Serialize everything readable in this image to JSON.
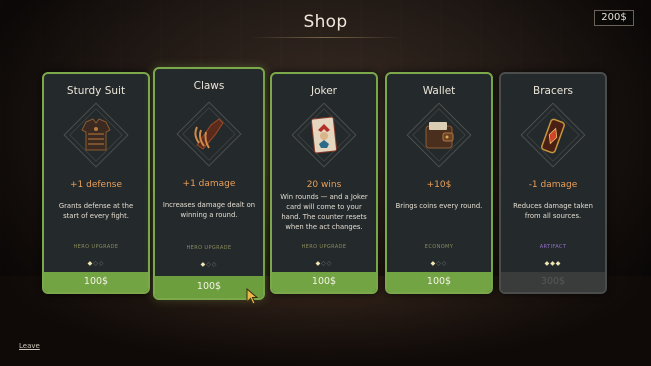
{
  "header": {
    "title": "Shop",
    "money": "200$"
  },
  "footer": {
    "leave_label": "Leave"
  },
  "colors": {
    "frame_green": "#7aa84a",
    "price_green": "#73a444",
    "stat_orange": "#e9a05a",
    "artifact_purple": "#8f72c9"
  },
  "cards": [
    {
      "name": "Sturdy Suit",
      "stat": "+1 defense",
      "description": "Grants defense at the start of every fight.",
      "category": "Hero upgrade",
      "level": 1,
      "max_level": 3,
      "price": "100$",
      "available": true,
      "icon": "armor-icon"
    },
    {
      "name": "Claws",
      "stat": "+1 damage",
      "description": "Increases damage dealt on winning a round.",
      "category": "Hero upgrade",
      "level": 1,
      "max_level": 3,
      "price": "100$",
      "available": true,
      "icon": "claws-icon"
    },
    {
      "name": "Joker",
      "stat": "20 wins",
      "description": "Win rounds — and a Joker card will come to your hand. The counter resets when the act changes.",
      "category": "Hero upgrade",
      "level": 1,
      "max_level": 3,
      "price": "100$",
      "available": true,
      "icon": "joker-card-icon"
    },
    {
      "name": "Wallet",
      "stat": "+10$",
      "description": "Brings coins every round.",
      "category": "Economy",
      "level": 1,
      "max_level": 3,
      "price": "100$",
      "available": true,
      "icon": "wallet-icon"
    },
    {
      "name": "Bracers",
      "stat": "-1 damage",
      "description": "Reduces damage taken from all sources.",
      "category": "Artifact",
      "level": 3,
      "max_level": 3,
      "price": "300$",
      "available": false,
      "icon": "bracer-icon"
    }
  ]
}
